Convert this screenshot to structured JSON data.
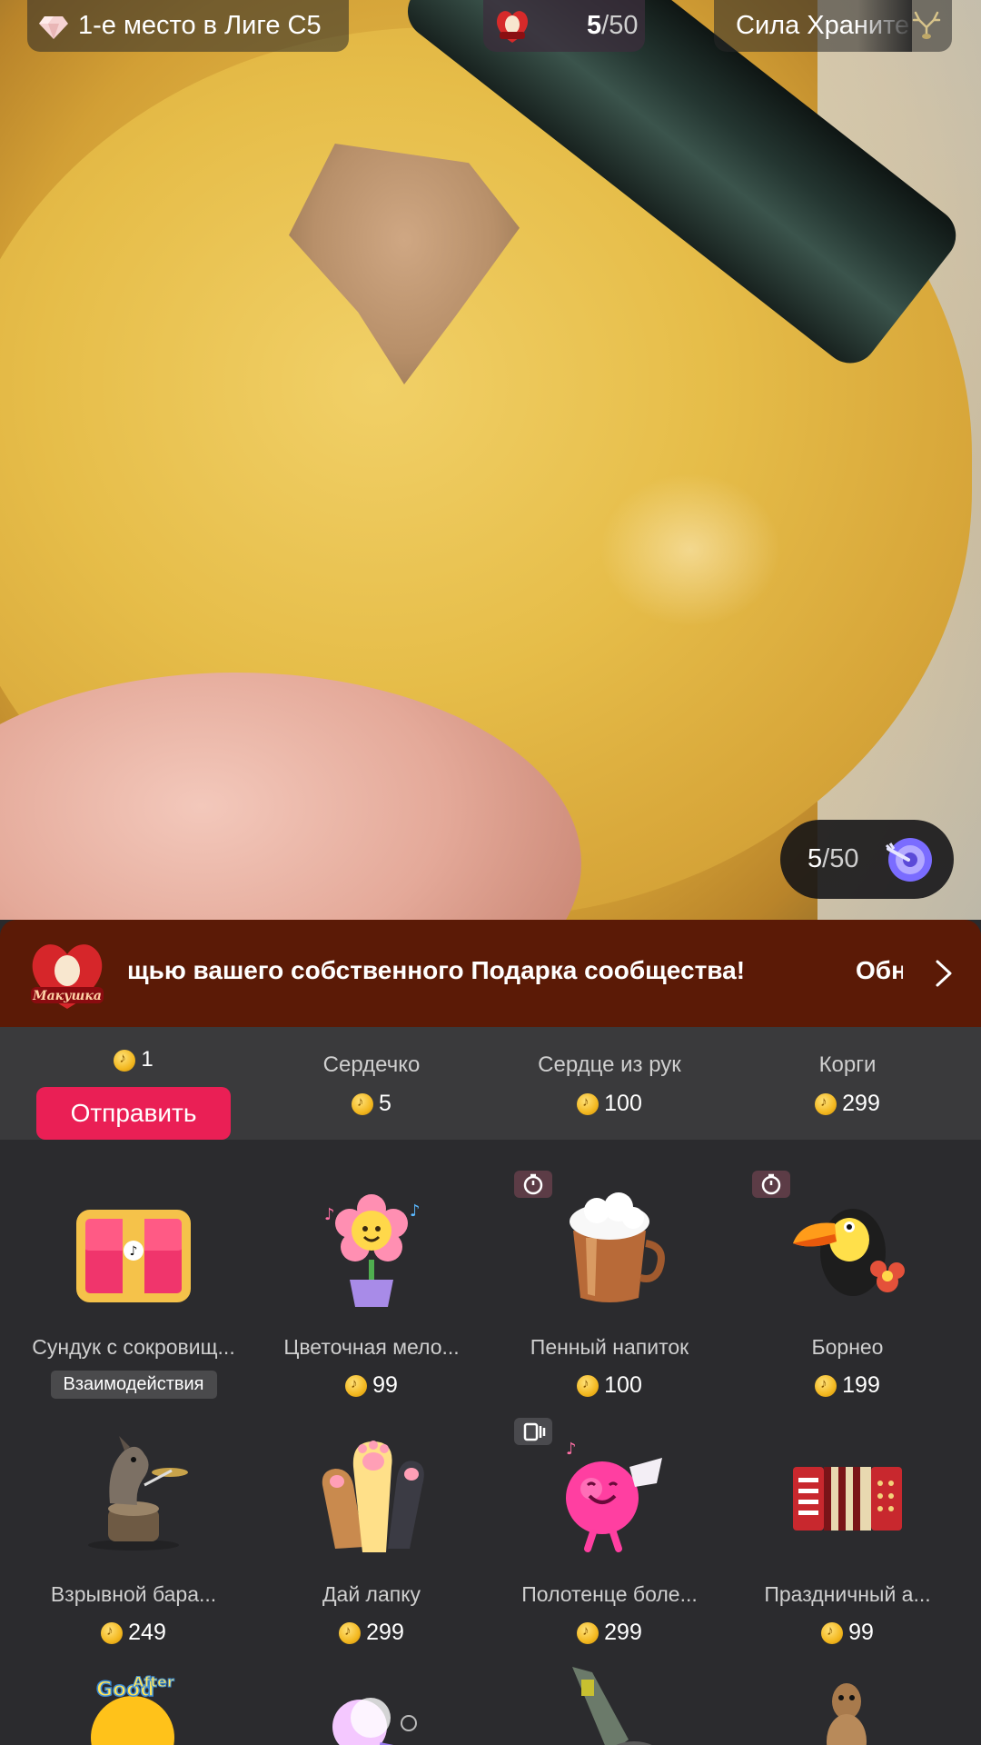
{
  "top_bar": {
    "league_text": "1-е место в Лиге С5",
    "counter_current": "5",
    "counter_total": "/50",
    "power_text": "Сила Храните"
  },
  "goal": {
    "current": "5",
    "total": "/50"
  },
  "banner": {
    "message": "щью вашего собственного Подарка сообщества!",
    "more": "Обновить"
  },
  "selected_gift": {
    "price": "1",
    "send_label": "Отправить"
  },
  "gift_row1": [
    {
      "name": "Сердечко",
      "price": "5"
    },
    {
      "name": "Сердце из рук",
      "price": "100"
    },
    {
      "name": "Корги",
      "price": "299"
    }
  ],
  "gifts": [
    {
      "name": "Сундук с сокровищ...",
      "tag": "Взаимодействия",
      "icon": "treasure-chest-icon"
    },
    {
      "name": "Цветочная мело...",
      "price": "99",
      "icon": "flower-pot-icon"
    },
    {
      "name": "Пенный напиток",
      "price": "100",
      "icon": "foam-drink-icon",
      "badge": "timer"
    },
    {
      "name": "Борнео",
      "price": "199",
      "icon": "toucan-icon",
      "badge": "timer"
    },
    {
      "name": "Взрывной бара...",
      "price": "249",
      "icon": "drummer-icon"
    },
    {
      "name": "Дай лапку",
      "price": "299",
      "icon": "paws-icon"
    },
    {
      "name": "Полотенце боле...",
      "price": "299",
      "icon": "towel-ball-icon",
      "badge": "video"
    },
    {
      "name": "Праздничный а...",
      "price": "99",
      "icon": "accordion-icon"
    }
  ],
  "colors": {
    "send_button": "#ea1f55",
    "banner": "#5b1a06",
    "panel": "#2b2b2e",
    "coin": "#f3b820"
  }
}
